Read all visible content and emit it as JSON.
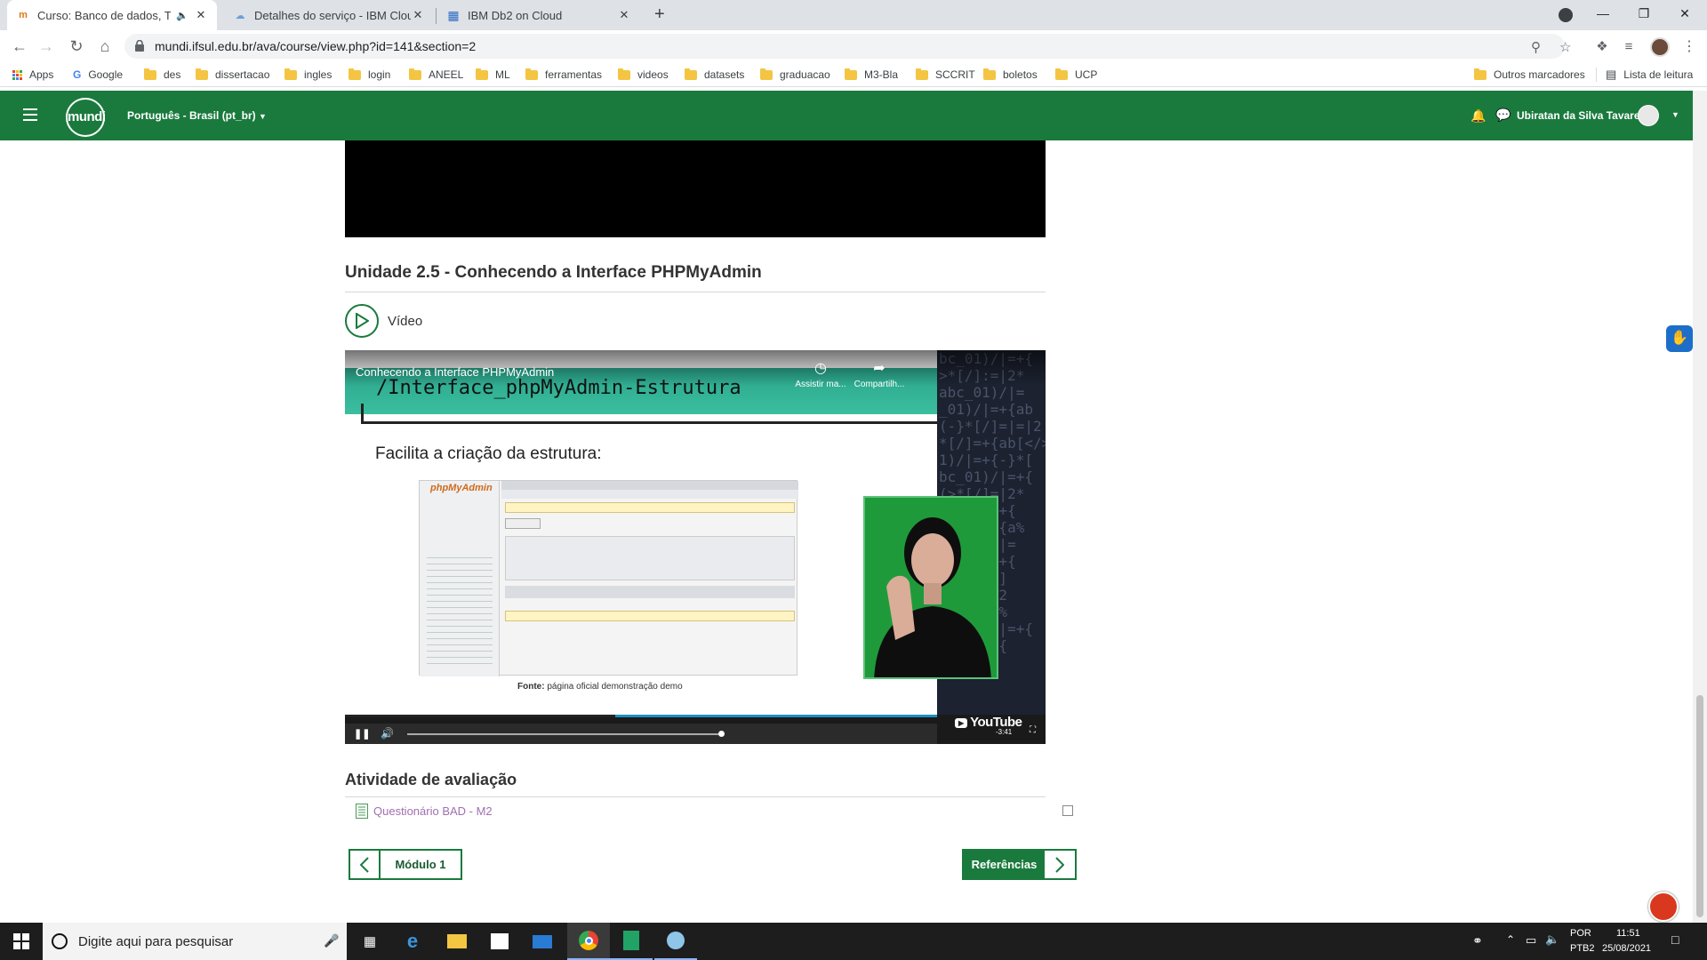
{
  "browser": {
    "tabs": [
      {
        "title": "Curso: Banco de dados, Tópic",
        "active": true,
        "audio": true
      },
      {
        "title": "Detalhes do serviço - IBM Cloud",
        "active": false
      },
      {
        "title": "IBM Db2 on Cloud",
        "active": false
      }
    ],
    "url": "mundi.ifsul.edu.br/ava/course/view.php?id=141&section=2",
    "bookmarks": [
      {
        "label": "Apps",
        "kind": "apps"
      },
      {
        "label": "Google",
        "kind": "google"
      },
      {
        "label": "des",
        "kind": "folder"
      },
      {
        "label": "dissertacao",
        "kind": "folder"
      },
      {
        "label": "ingles",
        "kind": "folder"
      },
      {
        "label": "login",
        "kind": "folder"
      },
      {
        "label": "ANEEL",
        "kind": "folder"
      },
      {
        "label": "ML",
        "kind": "folder"
      },
      {
        "label": "ferramentas",
        "kind": "folder"
      },
      {
        "label": "videos",
        "kind": "folder"
      },
      {
        "label": "datasets",
        "kind": "folder"
      },
      {
        "label": "graduacao",
        "kind": "folder"
      },
      {
        "label": "M3-Bla",
        "kind": "folder"
      },
      {
        "label": "SCCRIT",
        "kind": "folder"
      },
      {
        "label": "boletos",
        "kind": "folder"
      },
      {
        "label": "UCP",
        "kind": "folder"
      }
    ],
    "other_bookmarks": "Outros marcadores",
    "reading_list": "Lista de leitura"
  },
  "site": {
    "logo": "mundi",
    "language": "Português - Brasil (pt_br)",
    "user": "Ubiratan da Silva Tavares"
  },
  "section": {
    "title": "Unidade 2.5 - Conhecendo a Interface PHPMyAdmin",
    "video_label": "Vídeo"
  },
  "player": {
    "title": "Conhecendo a Interface PHPMyAdmin",
    "watch_later": "Assistir ma...",
    "share": "Compartilh...",
    "slide_heading": "/Interface_phpMyAdmin-Estrutura",
    "slide_sub": "Facilita a criação da estrutura:",
    "caption_bold": "Fonte:",
    "caption": "página oficial demonstração demo",
    "code_text": "bc_01)/|=+{\n>*[/]:=|2*\nabc_01)/|=\n_01)/|=+{ab\n(-}*[/]=|=|2\n*[/]=+{ab[</>]\n1)/|=+{-}*[\nbc_01)/|=+{\n(>*[/]=|2*\n/>]*/|=+{\n]/=|2*+{a%\n<[</>]*|=\n/>]*/|=+{\n>]*[</>]\n</>]*/|2\n=|2*+{a%\nbc_01)/|=+{\n>]*/|=+{",
    "logo": "YouTube",
    "time": "-3:41",
    "progress": 0.38
  },
  "evaluation": {
    "title": "Atividade de avaliação",
    "quiz": "Questionário BAD - M2"
  },
  "nav": {
    "prev": "Módulo 1",
    "next": "Referências"
  },
  "taskbar": {
    "search_placeholder": "Digite aqui para pesquisar",
    "lang": "POR",
    "layout": "PTB2",
    "time": "11:51",
    "date": "25/08/2021"
  },
  "colors": {
    "brand": "#1a7a3d",
    "link": "#a070b0"
  }
}
